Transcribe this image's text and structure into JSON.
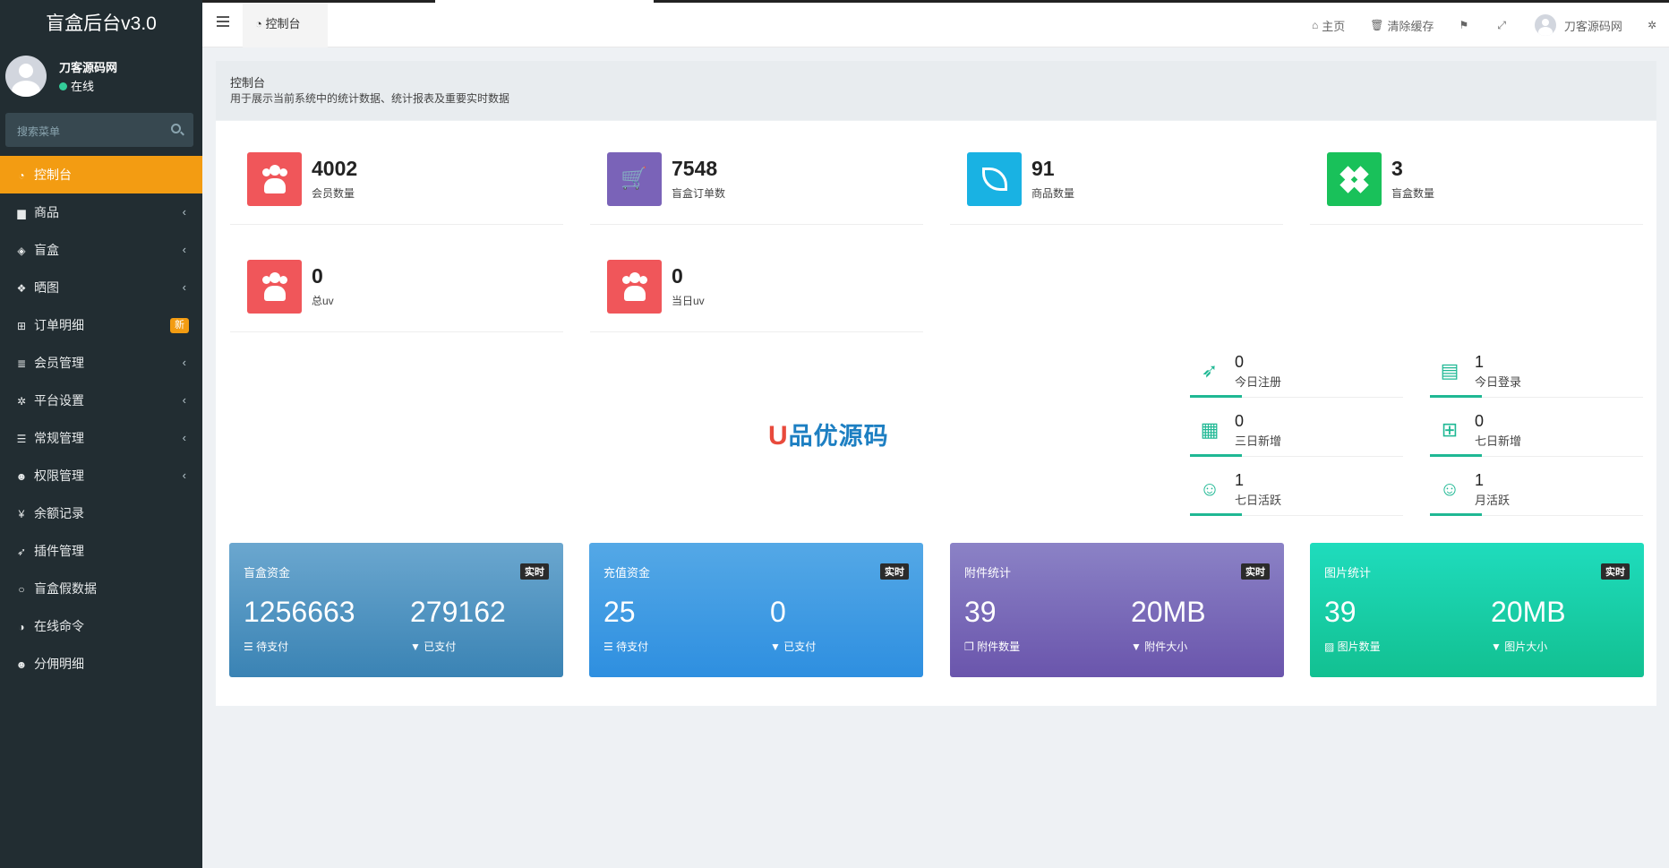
{
  "app_title": "盲盒后台v3.0",
  "user": {
    "name": "刀客源码网",
    "status": "在线"
  },
  "search": {
    "placeholder": "搜索菜单"
  },
  "sidebar": {
    "items": [
      {
        "label": "控制台",
        "icon": "dashboard-icon",
        "glyph": "◔"
      },
      {
        "label": "商品",
        "icon": "shopping-bag-icon",
        "glyph": "▆"
      },
      {
        "label": "盲盒",
        "icon": "cube-icon",
        "glyph": "◈"
      },
      {
        "label": "晒图",
        "icon": "dropbox-icon",
        "glyph": "❖"
      },
      {
        "label": "订单明细",
        "icon": "cart-icon",
        "glyph": "⊞",
        "badge": "新"
      },
      {
        "label": "会员管理",
        "icon": "list-icon",
        "glyph": "≣"
      },
      {
        "label": "平台设置",
        "icon": "gear-icon",
        "glyph": "✲"
      },
      {
        "label": "常规管理",
        "icon": "database-icon",
        "glyph": "☰"
      },
      {
        "label": "权限管理",
        "icon": "users-icon",
        "glyph": "☻"
      },
      {
        "label": "余额记录",
        "icon": "yen-icon",
        "glyph": "¥"
      },
      {
        "label": "插件管理",
        "icon": "rocket-icon",
        "glyph": "➶"
      },
      {
        "label": "盲盒假数据",
        "icon": "circle-icon",
        "glyph": "○"
      },
      {
        "label": "在线命令",
        "icon": "half-circle-icon",
        "glyph": "◑"
      },
      {
        "label": "分佣明细",
        "icon": "users-icon",
        "glyph": "☻"
      }
    ]
  },
  "header": {
    "tab": "控制台",
    "home": "主页",
    "clear_cache": "清除缓存",
    "user": "刀客源码网"
  },
  "content": {
    "title": "控制台",
    "subtitle": "用于展示当前系统中的统计数据、统计报表及重要实时数据"
  },
  "stats": [
    {
      "value": "4002",
      "label": "会员数量",
      "color": "#f0565a"
    },
    {
      "value": "7548",
      "label": "盲盒订单数",
      "color": "#7a63b8"
    },
    {
      "value": "91",
      "label": "商品数量",
      "color": "#19b2e3"
    },
    {
      "value": "3",
      "label": "盲盒数量",
      "color": "#19c15a"
    },
    {
      "value": "0",
      "label": "总uv",
      "color": "#f0565a"
    },
    {
      "value": "0",
      "label": "当日uv",
      "color": "#f0565a"
    }
  ],
  "logo_text": {
    "mark": "U",
    "text": "品优源码"
  },
  "mini_stats": [
    {
      "value": "0",
      "label": "今日注册",
      "icon": "rocket-icon"
    },
    {
      "value": "1",
      "label": "今日登录",
      "icon": "id-card-icon"
    },
    {
      "value": "0",
      "label": "三日新增",
      "icon": "calendar-icon"
    },
    {
      "value": "0",
      "label": "七日新增",
      "icon": "calendar-plus-icon"
    },
    {
      "value": "1",
      "label": "七日活跃",
      "icon": "user-circle-icon"
    },
    {
      "value": "1",
      "label": "月活跃",
      "icon": "user-circle-icon"
    }
  ],
  "cards": [
    {
      "title": "盲盒资金",
      "badge": "实时",
      "v1": "1256663",
      "l1": "待支付",
      "v2": "279162",
      "l2": "已支付"
    },
    {
      "title": "充值资金",
      "badge": "实时",
      "v1": "25",
      "l1": "待支付",
      "v2": "0",
      "l2": "已支付"
    },
    {
      "title": "附件统计",
      "badge": "实时",
      "v1": "39",
      "l1": "附件数量",
      "v2": "20MB",
      "l2": "附件大小"
    },
    {
      "title": "图片统计",
      "badge": "实时",
      "v1": "39",
      "l1": "图片数量",
      "v2": "20MB",
      "l2": "图片大小"
    }
  ]
}
